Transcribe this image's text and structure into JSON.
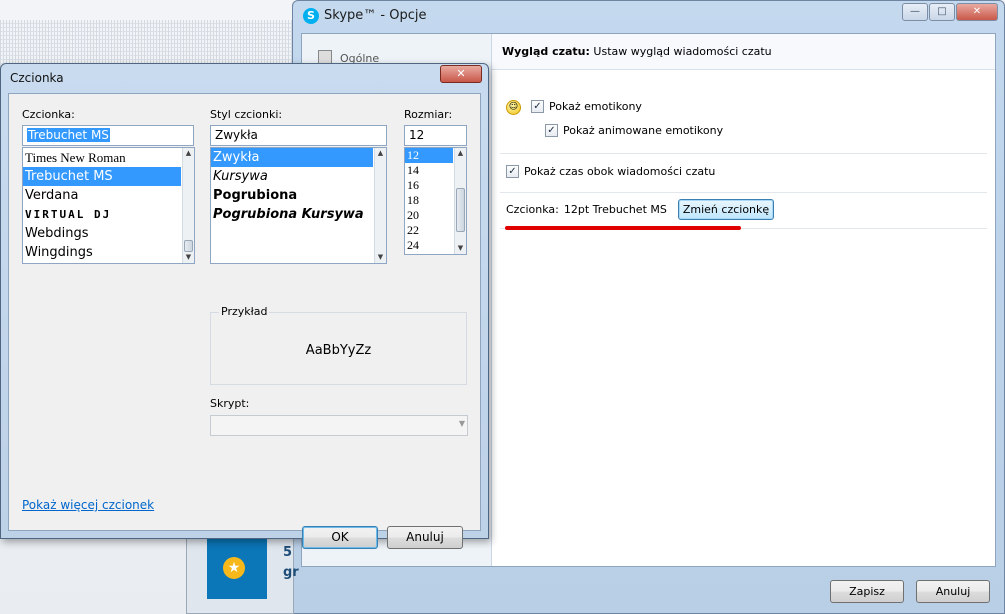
{
  "skype_window": {
    "logo_text": "S",
    "title": "Skype™ - Opcje",
    "controls": {
      "minimize": "—",
      "maximize": "□",
      "close": "✕"
    },
    "nav_item": "Ogólne",
    "header_bold": "Wygląd czatu:",
    "header_text": "Ustaw wygląd wiadomości czatu",
    "smiley": "☺",
    "show_emoticons": {
      "label": "Pokaż emotikony",
      "checked": "✓"
    },
    "show_animated": {
      "label": "Pokaż animowane emotikony",
      "checked": "✓"
    },
    "show_time": {
      "label": "Pokaż czas obok wiadomości czatu",
      "checked": "✓"
    },
    "font_label": "Czcionka:",
    "font_value": "12pt Trebuchet MS",
    "change_font_button": "Zmień czcionkę",
    "save_button": "Zapisz",
    "cancel_button": "Anuluj"
  },
  "promo": {
    "star": "★",
    "text": "5 gr"
  },
  "font_dialog": {
    "title": "Czcionka",
    "close": "✕",
    "font_label": "Czcionka:",
    "font_value": "Trebuchet MS",
    "fonts": [
      {
        "name": "Times New Roman",
        "selected": false
      },
      {
        "name": "Trebuchet MS",
        "selected": true
      },
      {
        "name": "Verdana",
        "selected": false
      },
      {
        "name": "VIRTUAL DJ",
        "selected": false
      },
      {
        "name": "Webdings",
        "selected": false
      },
      {
        "name": "Wingdings",
        "selected": false
      }
    ],
    "style_label": "Styl czcionki:",
    "style_value": "Zwykła",
    "styles": [
      {
        "name": "Zwykła",
        "selected": true
      },
      {
        "name": "Kursywa",
        "selected": false
      },
      {
        "name": "Pogrubiona",
        "selected": false
      },
      {
        "name": "Pogrubiona Kursywa",
        "selected": false
      }
    ],
    "size_label": "Rozmiar:",
    "size_value": "12",
    "sizes": [
      {
        "name": "12",
        "selected": true
      },
      {
        "name": "14",
        "selected": false
      },
      {
        "name": "16",
        "selected": false
      },
      {
        "name": "18",
        "selected": false
      },
      {
        "name": "20",
        "selected": false
      },
      {
        "name": "22",
        "selected": false
      },
      {
        "name": "24",
        "selected": false
      }
    ],
    "sample_label": "Przykład",
    "sample_text": "AaBbYyZz",
    "script_label": "Skrypt:",
    "more_fonts_link": "Pokaż więcej czcionek",
    "ok_button": "OK",
    "cancel_button": "Anuluj",
    "scroll_up": "▲",
    "scroll_down": "▼",
    "dropdown_arrow": "▼"
  }
}
